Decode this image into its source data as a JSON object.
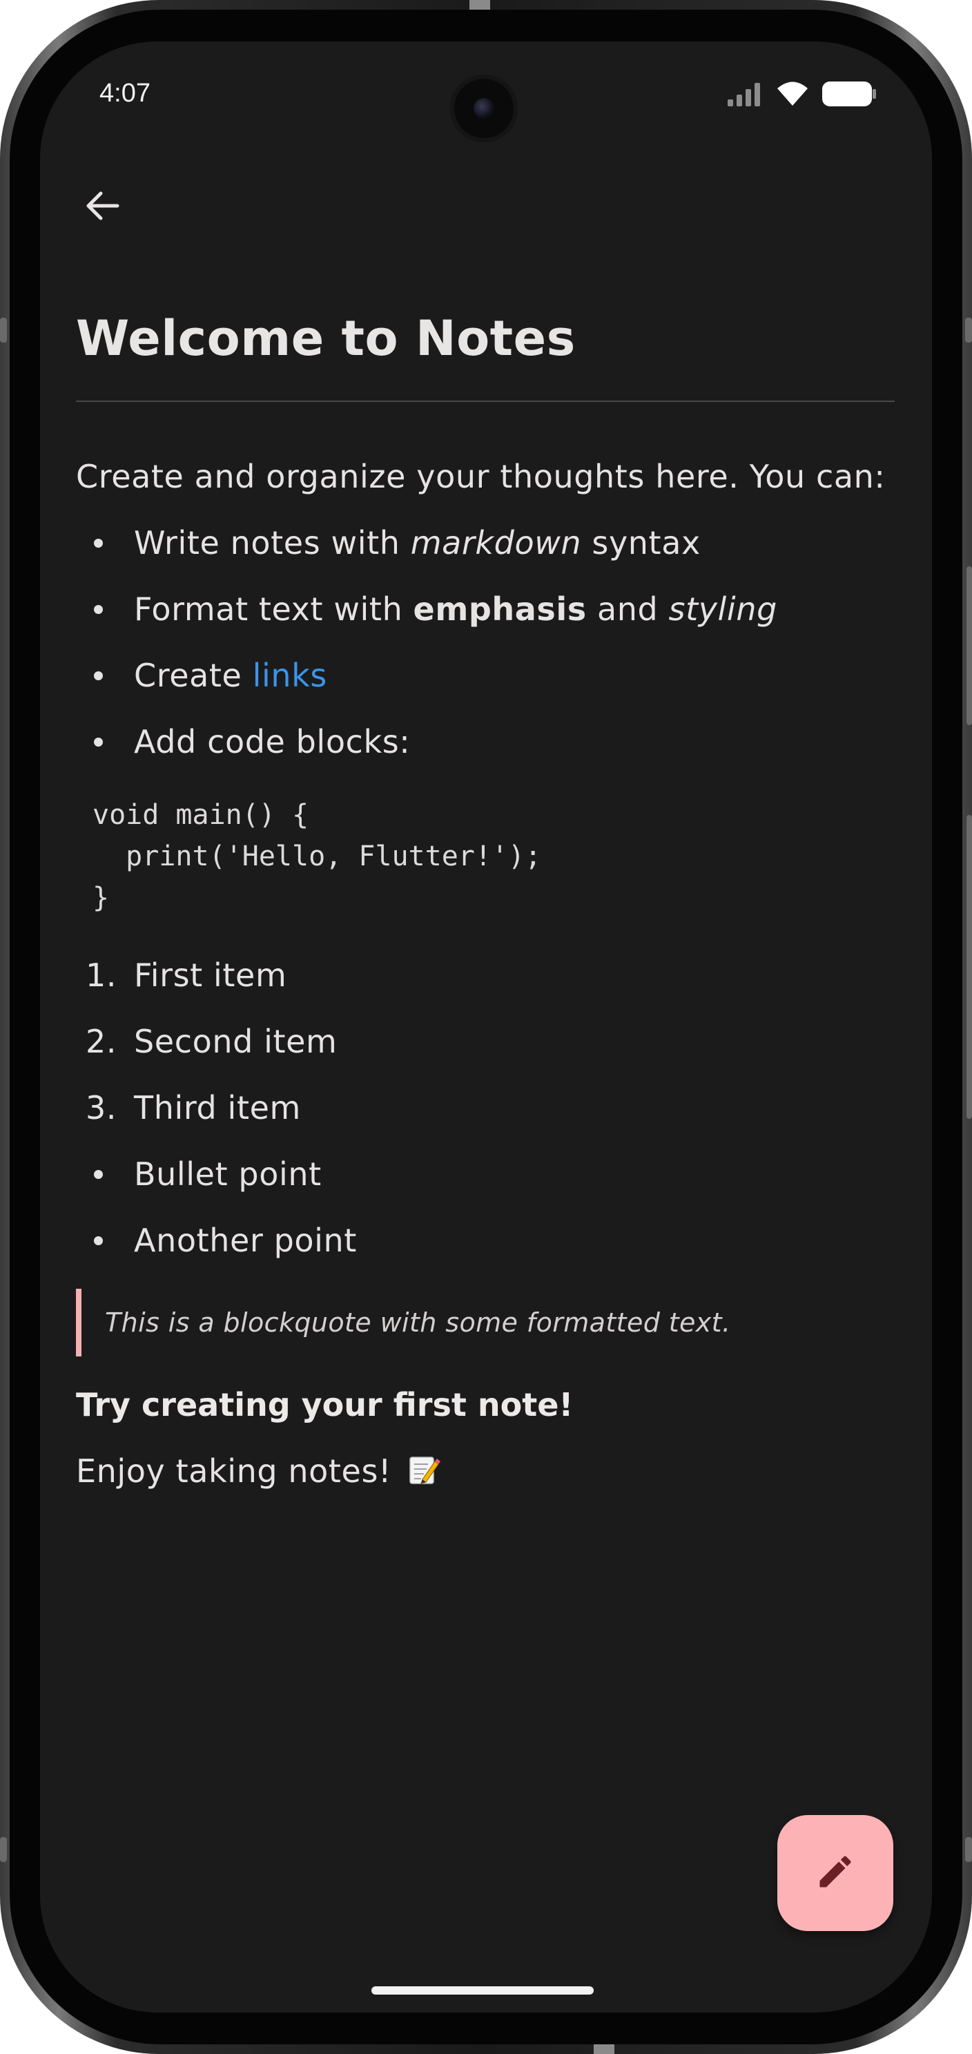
{
  "status_bar": {
    "time": "4:07",
    "icons": [
      "signal-icon",
      "wifi-icon",
      "battery-icon"
    ]
  },
  "app_bar": {
    "back_icon": "arrow-back-icon"
  },
  "note": {
    "title": "Welcome to Notes",
    "intro": "Create and organize your thoughts here. You can:",
    "bullets": {
      "item1": {
        "before": "Write notes with ",
        "em": "markdown",
        "after": " syntax"
      },
      "item2": {
        "before": "Format text with ",
        "strong": "emphasis",
        "middle": " and ",
        "em": "styling"
      },
      "item3": {
        "before": "Create ",
        "link": "links"
      },
      "item4": {
        "text": "Add code blocks:"
      }
    },
    "code_block": "void main() {\n  print('Hello, Flutter!');\n}",
    "ordered": [
      {
        "num": "1.",
        "text": "First item"
      },
      {
        "num": "2.",
        "text": "Second item"
      },
      {
        "num": "3.",
        "text": "Third item"
      }
    ],
    "points": [
      {
        "text": "Bullet point"
      },
      {
        "text": "Another point"
      }
    ],
    "blockquote": "This is a blockquote with some formatted text.",
    "cta": "Try creating your first note!",
    "closing": "Enjoy taking notes!",
    "closing_emoji": "memo-icon"
  },
  "fab": {
    "icon": "edit-pencil-icon"
  },
  "colors": {
    "background": "#1c1b1c",
    "text": "#e6e3e3",
    "link": "#3b95e8",
    "fab": "#fdb3b5",
    "fab_icon": "#6b2026",
    "blockquote_bar": "#f4b1b2"
  }
}
